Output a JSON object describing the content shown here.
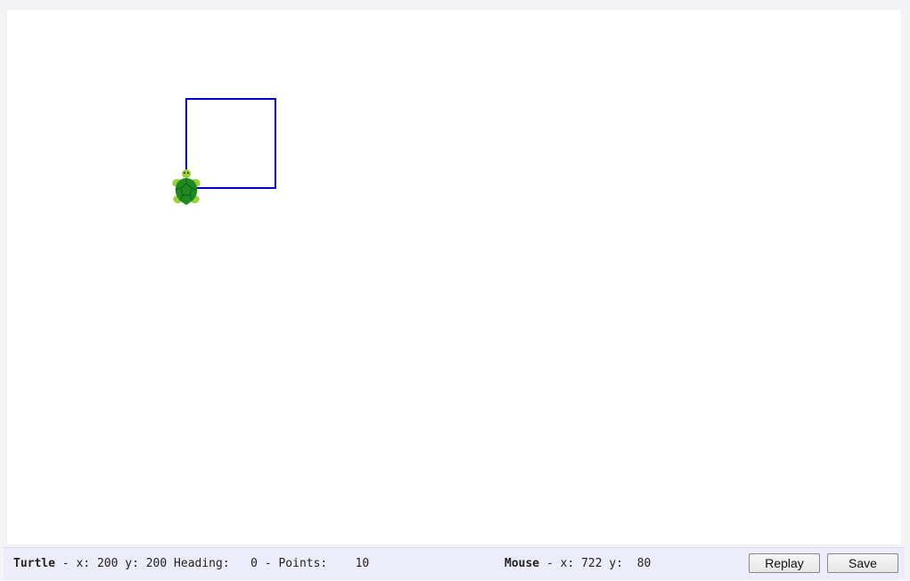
{
  "status": {
    "turtle_label": "Turtle",
    "turtle_x_label": "x:",
    "turtle_x": "200",
    "turtle_y_label": "y:",
    "turtle_y": "200",
    "heading_label": "Heading:",
    "heading": "0",
    "points_label": "Points:",
    "points": "10",
    "mouse_label": "Mouse",
    "mouse_x_label": "x:",
    "mouse_x": "722",
    "mouse_y_label": "y:",
    "mouse_y": "80",
    "separator": "-"
  },
  "buttons": {
    "replay": "Replay",
    "save": "Save"
  },
  "drawing": {
    "line_color": "#0000cc",
    "turtle_shell_color": "#1f8a1f",
    "turtle_shell_dark": "#15661a",
    "turtle_limb_color": "#9ad13a"
  }
}
